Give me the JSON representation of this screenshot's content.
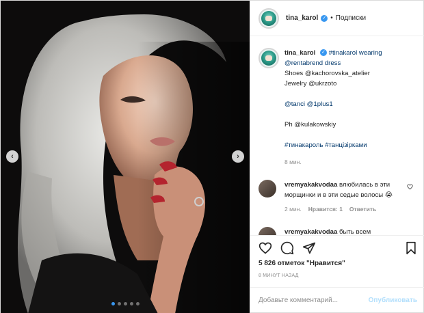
{
  "post": {
    "username": "tina_karol",
    "follow_status": "Подписки",
    "separator": "•"
  },
  "caption": {
    "username": "tina_karol",
    "lines": [
      "#tinakarol wearing",
      "@rentabrend dress",
      "Shoes @kachorovska_atelier",
      "Jewelry @ukrzoto",
      "",
      "@tanci @1plus1",
      "",
      "Ph @kulakowskiy",
      "",
      "#тинакароль #танцізірками"
    ],
    "time": "8 мин."
  },
  "comments": [
    {
      "username": "vremyakakvodaa",
      "text": "влюбилась в эти морщинки и в эти седые волосы 😭",
      "time": "2 мин.",
      "like_label": "Нравится: 1",
      "reply_label": "Ответить"
    },
    {
      "username": "vremyakakvodaa",
      "text": "быть всем"
    }
  ],
  "actions": {
    "likes_text": "5 826 отметок \"Нравится\"",
    "time_ago": "8 МИНУТ НАЗАД"
  },
  "comment_box": {
    "placeholder": "Добавьте комментарий...",
    "publish_label": "Опубликовать"
  },
  "carousel": {
    "total": 5,
    "active_index": 0
  },
  "colors": {
    "accent": "#3897f0",
    "link": "#00376b",
    "muted": "#8e8e8e",
    "publish_disabled": "#b2dffc"
  },
  "icons": {
    "like": "heart-icon",
    "comment": "comment-icon",
    "share": "paper-plane-icon",
    "save": "bookmark-icon",
    "prev": "chevron-left-icon",
    "next": "chevron-right-icon"
  }
}
